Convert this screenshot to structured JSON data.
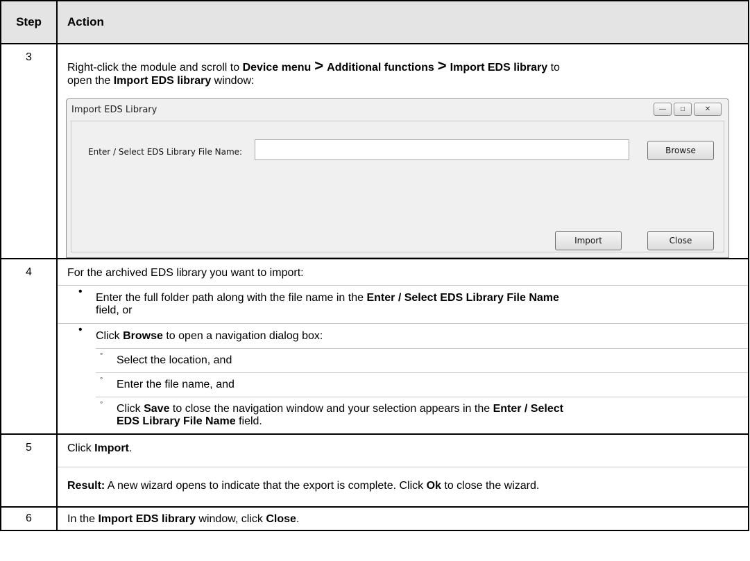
{
  "table": {
    "headers": {
      "step": "Step",
      "action": "Action"
    },
    "rows": [
      {
        "step": "3"
      },
      {
        "step": "4"
      },
      {
        "step": "5"
      },
      {
        "step": "6"
      }
    ]
  },
  "step3": {
    "t1": "Right-click the module and scroll to ",
    "b1": "Device menu",
    "gt1": ">",
    "b2": "Additional functions",
    "gt2": ">",
    "b3": "Import EDS library",
    "t2": " to",
    "t3": "open the ",
    "b4": "Import EDS library",
    "t4": " window:"
  },
  "dialog": {
    "title": "Import EDS Library",
    "min_glyph": "—",
    "max_glyph": "□",
    "close_glyph": "✕",
    "field_label": "Enter / Select EDS Library File Name:",
    "field_value": "",
    "browse": "Browse",
    "import": "Import",
    "close": "Close"
  },
  "step4": {
    "intro": "For the archived EDS library you want to import:",
    "bullet1": {
      "t1": "Enter the full folder path along with the file name in the ",
      "b1": "Enter / Select EDS Library File Name",
      "t2": "field, or"
    },
    "bullet2": {
      "t1": "Click ",
      "b1": "Browse",
      "t2": " to open a navigation dialog box:"
    },
    "sub1": "Select the location, and",
    "sub2": "Enter the file name, and",
    "sub3": {
      "t1": "Click ",
      "b1": "Save",
      "t2": " to close the navigation window and your selection appears in the ",
      "b2": "Enter / Select",
      "b3": "EDS Library File Name",
      "t3": " field."
    }
  },
  "step5": {
    "t1": "Click ",
    "b1": "Import",
    "t2": ".",
    "result_label": "Result:",
    "r1": " A new wizard opens to indicate that the export is complete. Click ",
    "r2": "Ok",
    "r3": " to close the wizard."
  },
  "step6": {
    "t1": "In the ",
    "b1": "Import EDS library",
    "t2": " window, click ",
    "b2": "Close",
    "t3": "."
  }
}
